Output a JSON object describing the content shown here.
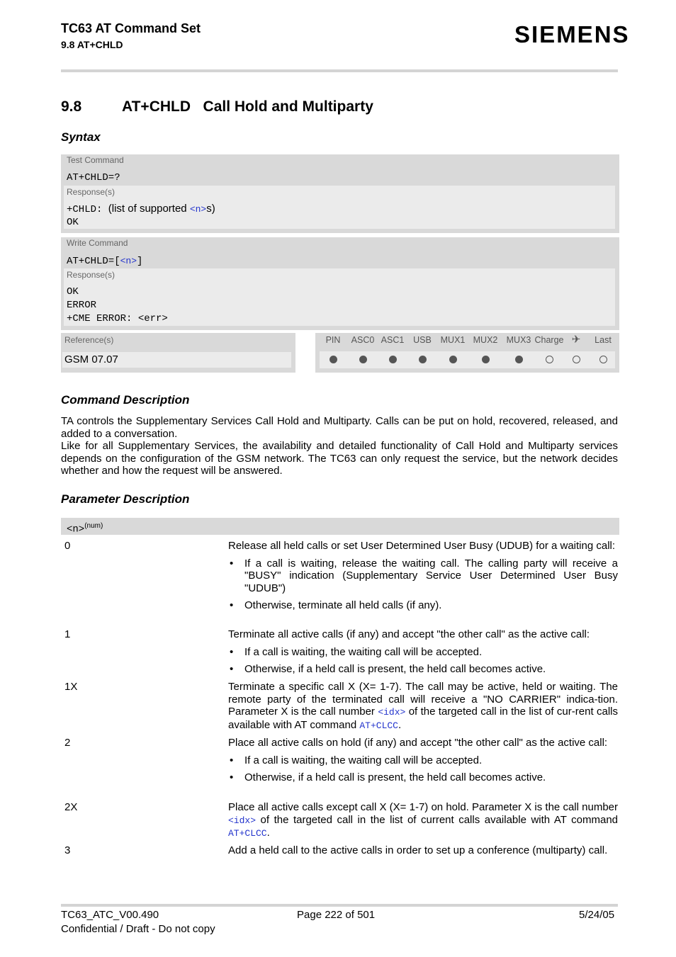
{
  "header": {
    "doc_title": "TC63 AT Command Set",
    "section_ref": "9.8 AT+CHLD",
    "brand": "SIEMENS"
  },
  "section": {
    "number": "9.8",
    "title": "AT+CHLD   Call Hold and Multiparty"
  },
  "syntax": {
    "heading": "Syntax",
    "test_command": {
      "label": "Test Command",
      "command": "AT+CHLD=?",
      "response_label": "Response(s)",
      "response_prefix": "+CHLD:",
      "response_text_before": "(list of supported ",
      "response_param": "<n>",
      "response_text_after": "s)",
      "response_ok": "OK"
    },
    "write_command": {
      "label": "Write Command",
      "command_prefix": "AT+CHLD=[",
      "command_param": "<n>",
      "command_suffix": "]",
      "response_label": "Response(s)",
      "responses": [
        "OK",
        "ERROR",
        "+CME ERROR: <err>"
      ]
    },
    "reference": {
      "label": "Reference(s)",
      "value": "GSM 07.07"
    },
    "flags": [
      {
        "label": "PIN",
        "supported": true
      },
      {
        "label": "ASC0",
        "supported": true
      },
      {
        "label": "ASC1",
        "supported": true
      },
      {
        "label": "USB",
        "supported": true
      },
      {
        "label": "MUX1",
        "supported": true
      },
      {
        "label": "MUX2",
        "supported": true
      },
      {
        "label": "MUX3",
        "supported": true
      },
      {
        "label": "Charge",
        "supported": false
      },
      {
        "label": "✈",
        "icon": "airplane-icon",
        "supported": false
      },
      {
        "label": "Last",
        "supported": false
      }
    ]
  },
  "command_description": {
    "heading": "Command Description",
    "paragraphs": [
      "TA controls the Supplementary Services Call Hold and Multiparty. Calls can be put on hold, recovered, released, and added to a conversation.",
      "Like for all Supplementary Services, the availability and detailed functionality of Call Hold and Multiparty services depends on the configuration of the GSM network. The TC63 can only request the service, but the network decides whether and how the request will be answered."
    ]
  },
  "parameter_description": {
    "heading": "Parameter Description",
    "param_name": "<n>",
    "param_type": "(num)",
    "values": [
      {
        "key": "0",
        "text": "Release all held calls or set User Determined User Busy (UDUB) for a waiting call:",
        "bullets": [
          "If a call is waiting, release the waiting call. The calling party will receive a \"BUSY\" indication (Supplementary Service User Determined User Busy \"UDUB\")",
          "Otherwise, terminate all held calls (if any)."
        ]
      },
      {
        "key": "1",
        "text": "Terminate all active calls (if any) and accept \"the other call\" as the active call:",
        "bullets": [
          "If a call is waiting, the waiting call will be accepted.",
          "Otherwise, if a held call is present, the held call becomes active."
        ]
      },
      {
        "key": "1X",
        "text_a": "Terminate a specific call X (X= 1-7). The call may be active, held or waiting. The remote party of the terminated call will receive a \"NO CARRIER\" indica-tion. Parameter X is the call number ",
        "link_a": "<idx>",
        "text_b": " of the targeted call in the list of cur-rent calls available with AT command ",
        "link_b": "AT+CLCC",
        "text_c": "."
      },
      {
        "key": "2",
        "text": "Place all active calls on hold (if any) and accept \"the other call\" as the active call:",
        "bullets": [
          "If a call is waiting, the waiting call will be accepted.",
          "Otherwise, if a held call is present, the held call becomes active."
        ]
      },
      {
        "key": "2X",
        "text_a": "Place all active calls except call X (X= 1-7) on hold. Parameter X is the call number ",
        "link_a": "<idx>",
        "text_b": " of the targeted call in the list of current calls available with AT command ",
        "link_b": "AT+CLCC",
        "text_c": "."
      },
      {
        "key": "3",
        "text": "Add a held call to the active calls in order to set up a conference (multiparty) call."
      }
    ]
  },
  "footer": {
    "doc_id": "TC63_ATC_V00.490",
    "page": "Page 222 of 501",
    "date": "5/24/05",
    "confidentiality": "Confidential / Draft - Do not copy"
  },
  "colors": {
    "link": "#2233cc",
    "box_outer": "#d9d9d9",
    "box_inner": "#ebebeb",
    "dot": "#555555"
  }
}
